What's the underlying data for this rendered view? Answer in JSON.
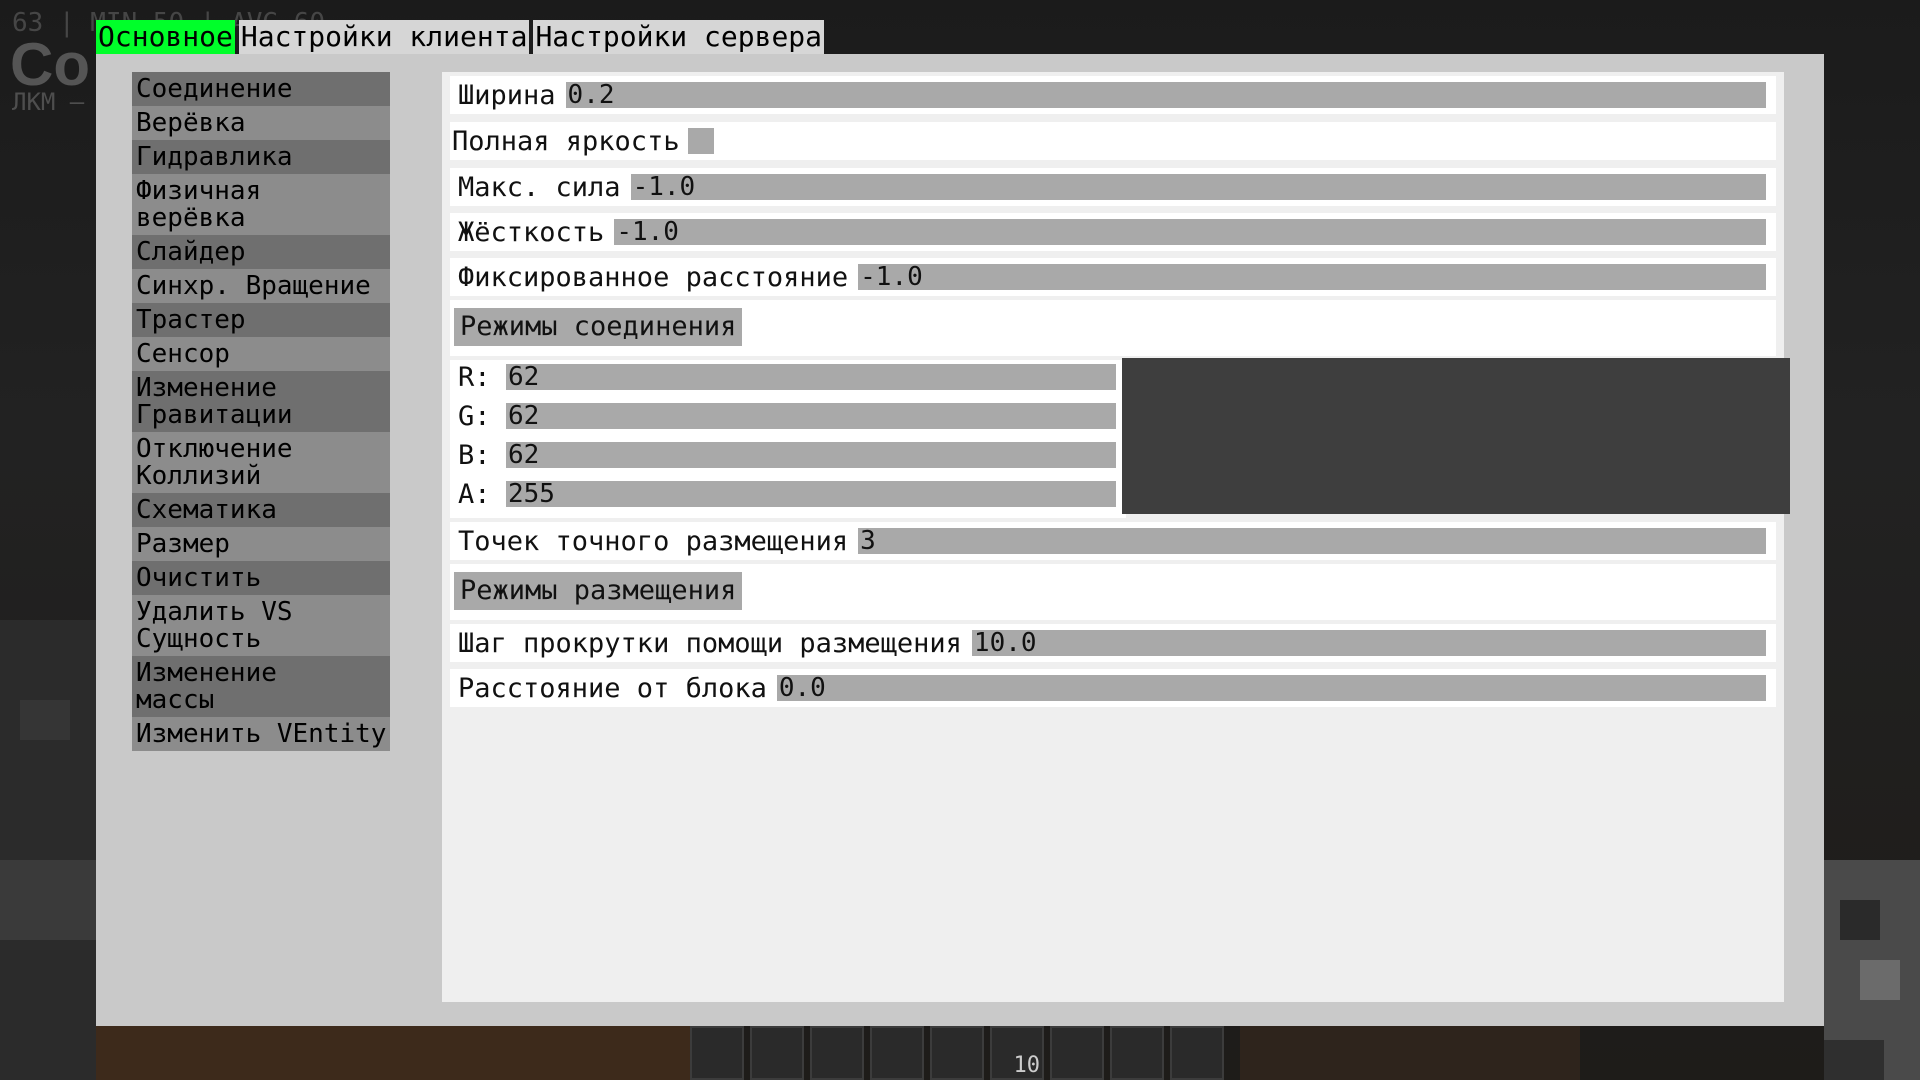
{
  "hud": {
    "top_line": "63 | MIN 50 | AVG 60",
    "big_text": "Со",
    "sub_text": "ЛКМ –"
  },
  "hotbar": {
    "count": "10"
  },
  "tabs": [
    "Основное",
    "Настройки клиента",
    "Настройки сервера"
  ],
  "active_tab": 0,
  "sidebar": [
    "Соединение",
    "Верёвка",
    "Гидравлика",
    "Физичная\nверёвка",
    "Слайдер",
    "Синхр. Вращение",
    "Трастер",
    "Сенсор",
    "Изменение\nГравитации",
    "Отключение\nКоллизий",
    "Схематика",
    "Размер",
    "Очистить",
    "Удалить VS\nСущность",
    "Изменение\nмассы",
    "Изменить VEntity"
  ],
  "settings": {
    "width": {
      "label": "Ширина",
      "value": "0.2"
    },
    "fullbright": {
      "label": "Полная яркость",
      "checked": false
    },
    "max_force": {
      "label": "Макс. сила",
      "value": "-1.0"
    },
    "stiffness": {
      "label": "Жёсткость",
      "value": "-1.0"
    },
    "fixed_distance": {
      "label": "Фиксированное расстояние",
      "value": "-1.0"
    },
    "connection_modes_button": "Режимы соединения",
    "color": {
      "r_label": "R:",
      "r": "62",
      "g_label": "G:",
      "g": "62",
      "b_label": "B:",
      "b": "62",
      "a_label": "A:",
      "a": "255",
      "preview_hex": "#3e3e3e"
    },
    "precise_points": {
      "label": "Точек точного размещения",
      "value": "3"
    },
    "placement_modes_button": "Режимы размещения",
    "scroll_step": {
      "label": "Шаг прокрутки помощи размещения",
      "value": "10.0"
    },
    "block_distance": {
      "label": "Расстояние от блока",
      "value": "0.0"
    }
  },
  "colors": {
    "active_tab": "#00ff2a",
    "window": "#c9c9c9",
    "content": "#efefef",
    "field": "#a9a9a9"
  }
}
